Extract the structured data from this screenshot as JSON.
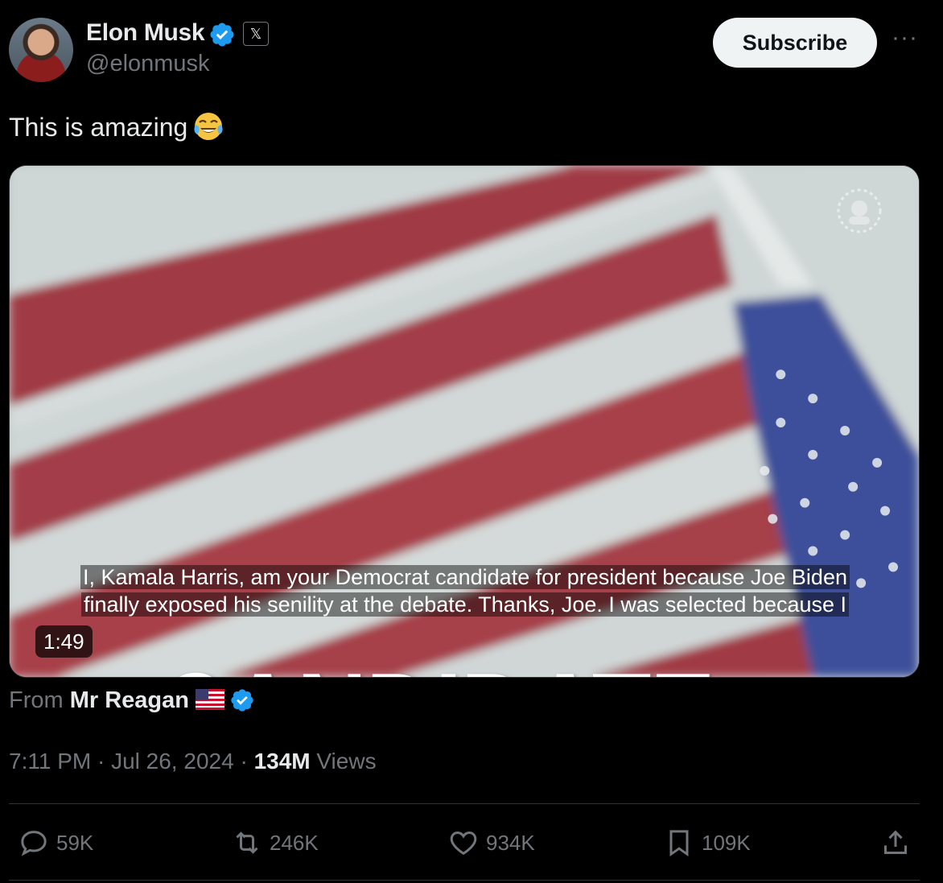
{
  "author": {
    "name": "Elon Musk",
    "handle": "@elonmusk",
    "badge_letter": "𝕏"
  },
  "header": {
    "subscribe_label": "Subscribe",
    "more_label": "···"
  },
  "tweet": {
    "text": "This is amazing"
  },
  "video": {
    "overlay_word": "CANDIDATE",
    "caption_line1": "I, Kamala Harris, am your Democrat candidate for president because Joe Biden",
    "caption_line2": "finally exposed his senility at the debate. Thanks, Joe. I was selected because I",
    "duration": "1:49"
  },
  "source": {
    "prefix": "From",
    "name": "Mr Reagan"
  },
  "meta": {
    "time": "7:11 PM",
    "sep1": " · ",
    "date": "Jul 26, 2024",
    "sep2": " · ",
    "views_count": "134M",
    "views_label": "Views"
  },
  "actions": {
    "replies": "59K",
    "reposts": "246K",
    "likes": "934K",
    "bookmarks": "109K"
  },
  "colors": {
    "background": "#000000",
    "text": "#e7e9ea",
    "muted": "#71767b",
    "verified": "#1d9bf0",
    "subscribe_bg": "#eff3f4"
  },
  "icons": [
    "verified-icon",
    "x-logo-icon",
    "more-icon",
    "joy-emoji-icon",
    "us-flag-icon",
    "reply-icon",
    "repost-icon",
    "like-icon",
    "bookmark-icon",
    "share-icon"
  ]
}
